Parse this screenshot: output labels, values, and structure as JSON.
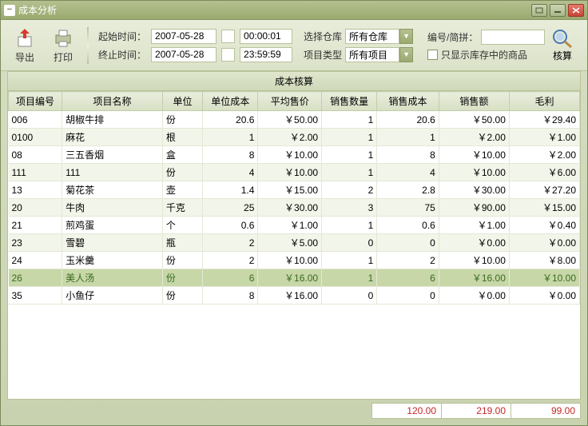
{
  "window": {
    "title": "成本分析"
  },
  "toolbar": {
    "export_label": "导出",
    "print_label": "打印",
    "start_label": "起始时间：",
    "end_label": "终止时间：",
    "start_date": "2007-05-28",
    "start_time": "00:00:01",
    "end_date": "2007-05-28",
    "end_time": "23:59:59",
    "warehouse_label": "选择仓库",
    "warehouse_value": "所有仓库",
    "project_type_label": "项目类型",
    "project_type_value": "所有项目",
    "code_label": "编号/简拼：",
    "code_value": "",
    "stock_only_label": "只显示库存中的商品",
    "calc_label": "核算"
  },
  "content_title": "成本核算",
  "columns": [
    "项目编号",
    "项目名称",
    "单位",
    "单位成本",
    "平均售价",
    "销售数量",
    "销售成本",
    "销售额",
    "毛利"
  ],
  "rows": [
    {
      "id": "006",
      "name": "胡椒牛排",
      "unit": "份",
      "unit_cost": "20.6",
      "avg_price": "￥50.00",
      "qty": "1",
      "sale_cost": "20.6",
      "sales": "￥50.00",
      "profit": "￥29.40"
    },
    {
      "id": "0100",
      "name": "麻花",
      "unit": "根",
      "unit_cost": "1",
      "avg_price": "￥2.00",
      "qty": "1",
      "sale_cost": "1",
      "sales": "￥2.00",
      "profit": "￥1.00"
    },
    {
      "id": "08",
      "name": "三五香烟",
      "unit": "盒",
      "unit_cost": "8",
      "avg_price": "￥10.00",
      "qty": "1",
      "sale_cost": "8",
      "sales": "￥10.00",
      "profit": "￥2.00"
    },
    {
      "id": "111",
      "name": "111",
      "unit": "份",
      "unit_cost": "4",
      "avg_price": "￥10.00",
      "qty": "1",
      "sale_cost": "4",
      "sales": "￥10.00",
      "profit": "￥6.00"
    },
    {
      "id": "13",
      "name": "菊花茶",
      "unit": "壶",
      "unit_cost": "1.4",
      "avg_price": "￥15.00",
      "qty": "2",
      "sale_cost": "2.8",
      "sales": "￥30.00",
      "profit": "￥27.20"
    },
    {
      "id": "20",
      "name": "牛肉",
      "unit": "千克",
      "unit_cost": "25",
      "avg_price": "￥30.00",
      "qty": "3",
      "sale_cost": "75",
      "sales": "￥90.00",
      "profit": "￥15.00"
    },
    {
      "id": "21",
      "name": "煎鸡蛋",
      "unit": "个",
      "unit_cost": "0.6",
      "avg_price": "￥1.00",
      "qty": "1",
      "sale_cost": "0.6",
      "sales": "￥1.00",
      "profit": "￥0.40"
    },
    {
      "id": "23",
      "name": "雪碧",
      "unit": "瓶",
      "unit_cost": "2",
      "avg_price": "￥5.00",
      "qty": "0",
      "sale_cost": "0",
      "sales": "￥0.00",
      "profit": "￥0.00"
    },
    {
      "id": "24",
      "name": "玉米羹",
      "unit": "份",
      "unit_cost": "2",
      "avg_price": "￥10.00",
      "qty": "1",
      "sale_cost": "2",
      "sales": "￥10.00",
      "profit": "￥8.00"
    },
    {
      "id": "26",
      "name": "美人汤",
      "unit": "份",
      "unit_cost": "6",
      "avg_price": "￥16.00",
      "qty": "1",
      "sale_cost": "6",
      "sales": "￥16.00",
      "profit": "￥10.00",
      "selected": true
    },
    {
      "id": "35",
      "name": "小鱼仔",
      "unit": "份",
      "unit_cost": "8",
      "avg_price": "￥16.00",
      "qty": "0",
      "sale_cost": "0",
      "sales": "￥0.00",
      "profit": "￥0.00"
    }
  ],
  "footer": {
    "total_cost": "120.00",
    "total_sales": "219.00",
    "total_profit": "99.00"
  }
}
